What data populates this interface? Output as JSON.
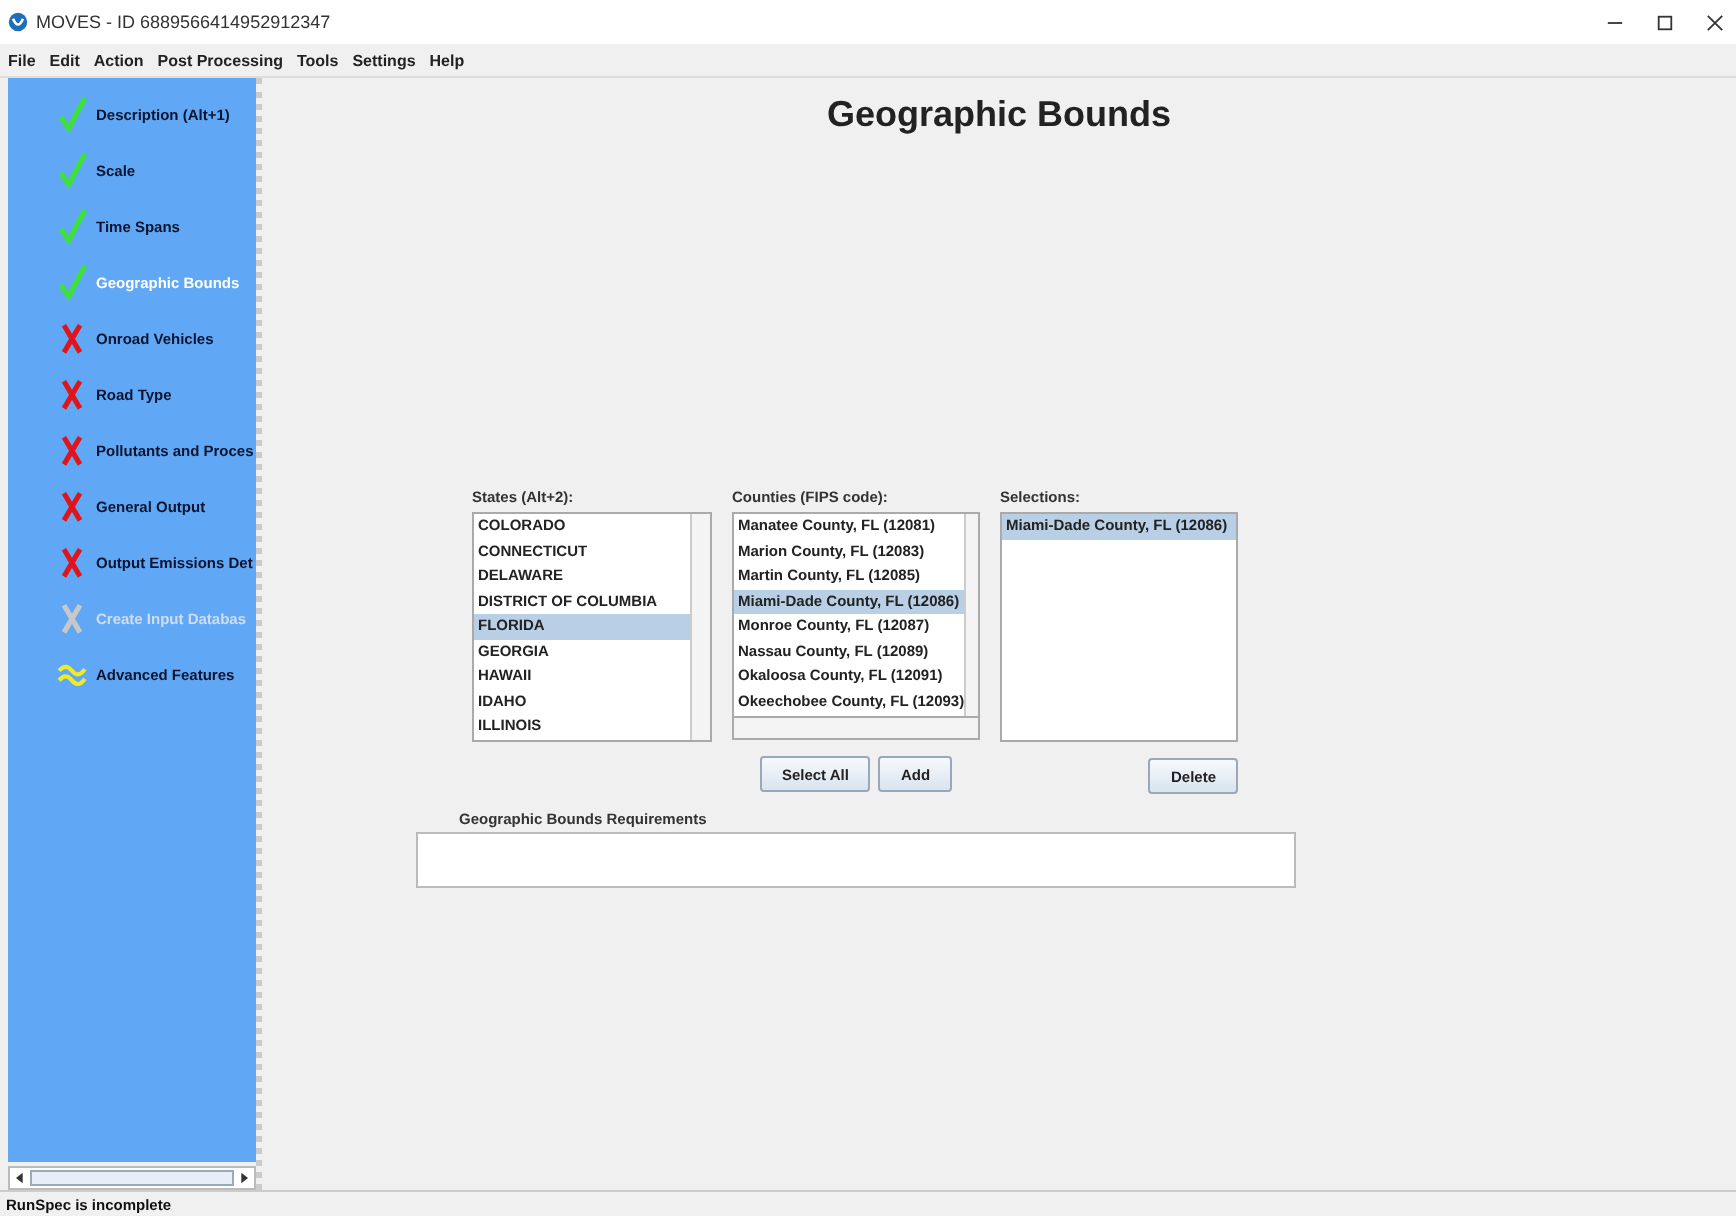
{
  "window": {
    "title": "MOVES - ID 6889566414952912347"
  },
  "menu": [
    "File",
    "Edit",
    "Action",
    "Post Processing",
    "Tools",
    "Settings",
    "Help"
  ],
  "sidebar": {
    "items": [
      {
        "label": "Description (Alt+1)",
        "kind": "check",
        "selected": false,
        "disabled": false
      },
      {
        "label": "Scale",
        "kind": "check",
        "selected": false,
        "disabled": false
      },
      {
        "label": "Time Spans",
        "kind": "check",
        "selected": false,
        "disabled": false
      },
      {
        "label": "Geographic Bounds",
        "kind": "check",
        "selected": true,
        "disabled": false
      },
      {
        "label": "Onroad Vehicles",
        "kind": "cross",
        "selected": false,
        "disabled": false
      },
      {
        "label": "Road Type",
        "kind": "cross",
        "selected": false,
        "disabled": false
      },
      {
        "label": "Pollutants and Proces",
        "kind": "cross",
        "selected": false,
        "disabled": false
      },
      {
        "label": "General Output",
        "kind": "cross",
        "selected": false,
        "disabled": false
      },
      {
        "label": "Output Emissions Det",
        "kind": "cross",
        "selected": false,
        "disabled": false
      },
      {
        "label": "Create Input Databas",
        "kind": "cross",
        "selected": false,
        "disabled": true
      },
      {
        "label": "Advanced Features",
        "kind": "approx",
        "selected": false,
        "disabled": false
      }
    ]
  },
  "heading": "Geographic Bounds",
  "states": {
    "label": "States (Alt+2):",
    "items": [
      {
        "label": "COLORADO",
        "selected": false
      },
      {
        "label": "CONNECTICUT",
        "selected": false
      },
      {
        "label": "DELAWARE",
        "selected": false
      },
      {
        "label": "DISTRICT OF COLUMBIA",
        "selected": false
      },
      {
        "label": "FLORIDA",
        "selected": true
      },
      {
        "label": "GEORGIA",
        "selected": false
      },
      {
        "label": "HAWAII",
        "selected": false
      },
      {
        "label": "IDAHO",
        "selected": false
      },
      {
        "label": "ILLINOIS",
        "selected": false
      }
    ]
  },
  "counties": {
    "label": "Counties (FIPS code):",
    "items": [
      {
        "label": "Manatee County, FL (12081)",
        "selected": false
      },
      {
        "label": "Marion County, FL (12083)",
        "selected": false
      },
      {
        "label": "Martin County, FL (12085)",
        "selected": false
      },
      {
        "label": "Miami-Dade County, FL (12086)",
        "selected": true
      },
      {
        "label": "Monroe County, FL (12087)",
        "selected": false
      },
      {
        "label": "Nassau County, FL (12089)",
        "selected": false
      },
      {
        "label": "Okaloosa County, FL (12091)",
        "selected": false
      },
      {
        "label": "Okeechobee County, FL (12093)",
        "selected": false
      }
    ]
  },
  "selections": {
    "label": "Selections:",
    "items": [
      {
        "label": "Miami-Dade County, FL (12086)",
        "selected": true
      }
    ]
  },
  "buttons": {
    "select_all": "Select All",
    "add": "Add",
    "delete": "Delete"
  },
  "requirements": {
    "label": "Geographic Bounds Requirements"
  },
  "status_bar": "RunSpec is incomplete"
}
